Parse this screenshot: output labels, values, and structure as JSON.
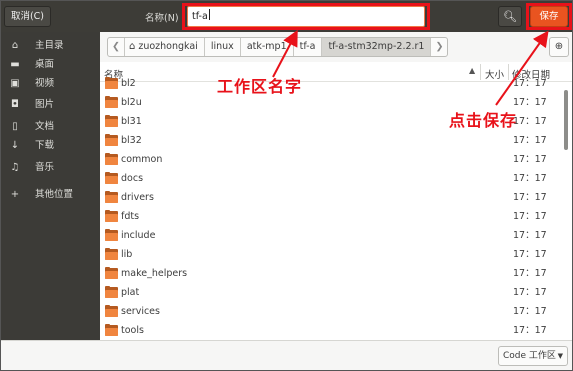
{
  "header": {
    "cancel_label": "取消(C)",
    "name_label": "名称(N)",
    "name_value": "tf-a",
    "search_icon": "magnifier-icon",
    "save_label": "保存"
  },
  "annotations": {
    "workspace_name": "工作区名字",
    "click_save": "点击保存",
    "color": "#e8121a"
  },
  "sidebar": {
    "items": [
      {
        "icon": "home-icon",
        "glyph": "⌂",
        "label": "主目录"
      },
      {
        "icon": "desktop-icon",
        "glyph": "▬",
        "label": "桌面"
      },
      {
        "icon": "video-icon",
        "glyph": "▣",
        "label": "视频"
      },
      {
        "icon": "camera-icon",
        "glyph": "◘",
        "label": "图片"
      },
      {
        "icon": "document-icon",
        "glyph": "▯",
        "label": "文档"
      },
      {
        "icon": "download-icon",
        "glyph": "↓",
        "label": "下载"
      },
      {
        "icon": "music-icon",
        "glyph": "♫",
        "label": "音乐"
      },
      {
        "icon": "plus-icon",
        "glyph": "+",
        "label": "其他位置"
      }
    ]
  },
  "pathbar": {
    "crumbs": [
      "zuozhongkai",
      "linux",
      "atk-mp1",
      "tf-a",
      "tf-a-stm32mp-2.2.r1"
    ]
  },
  "list": {
    "col_name": "名称",
    "col_size": "大小",
    "col_date": "修改日期",
    "rows": [
      {
        "name": "bl2",
        "date": "17：17"
      },
      {
        "name": "bl2u",
        "date": "17：17"
      },
      {
        "name": "bl31",
        "date": "17：17"
      },
      {
        "name": "bl32",
        "date": "17：17"
      },
      {
        "name": "common",
        "date": "17：17"
      },
      {
        "name": "docs",
        "date": "17：17"
      },
      {
        "name": "drivers",
        "date": "17：17"
      },
      {
        "name": "fdts",
        "date": "17：17"
      },
      {
        "name": "include",
        "date": "17：17"
      },
      {
        "name": "lib",
        "date": "17：17"
      },
      {
        "name": "make_helpers",
        "date": "17：17"
      },
      {
        "name": "plat",
        "date": "17：17"
      },
      {
        "name": "services",
        "date": "17：17"
      },
      {
        "name": "tools",
        "date": "17：17"
      }
    ]
  },
  "footer": {
    "filter_value": "Code 工作区"
  },
  "colors": {
    "accent": "#e95420",
    "folder": "#f0853f",
    "sidebar": "#3c3b37"
  }
}
